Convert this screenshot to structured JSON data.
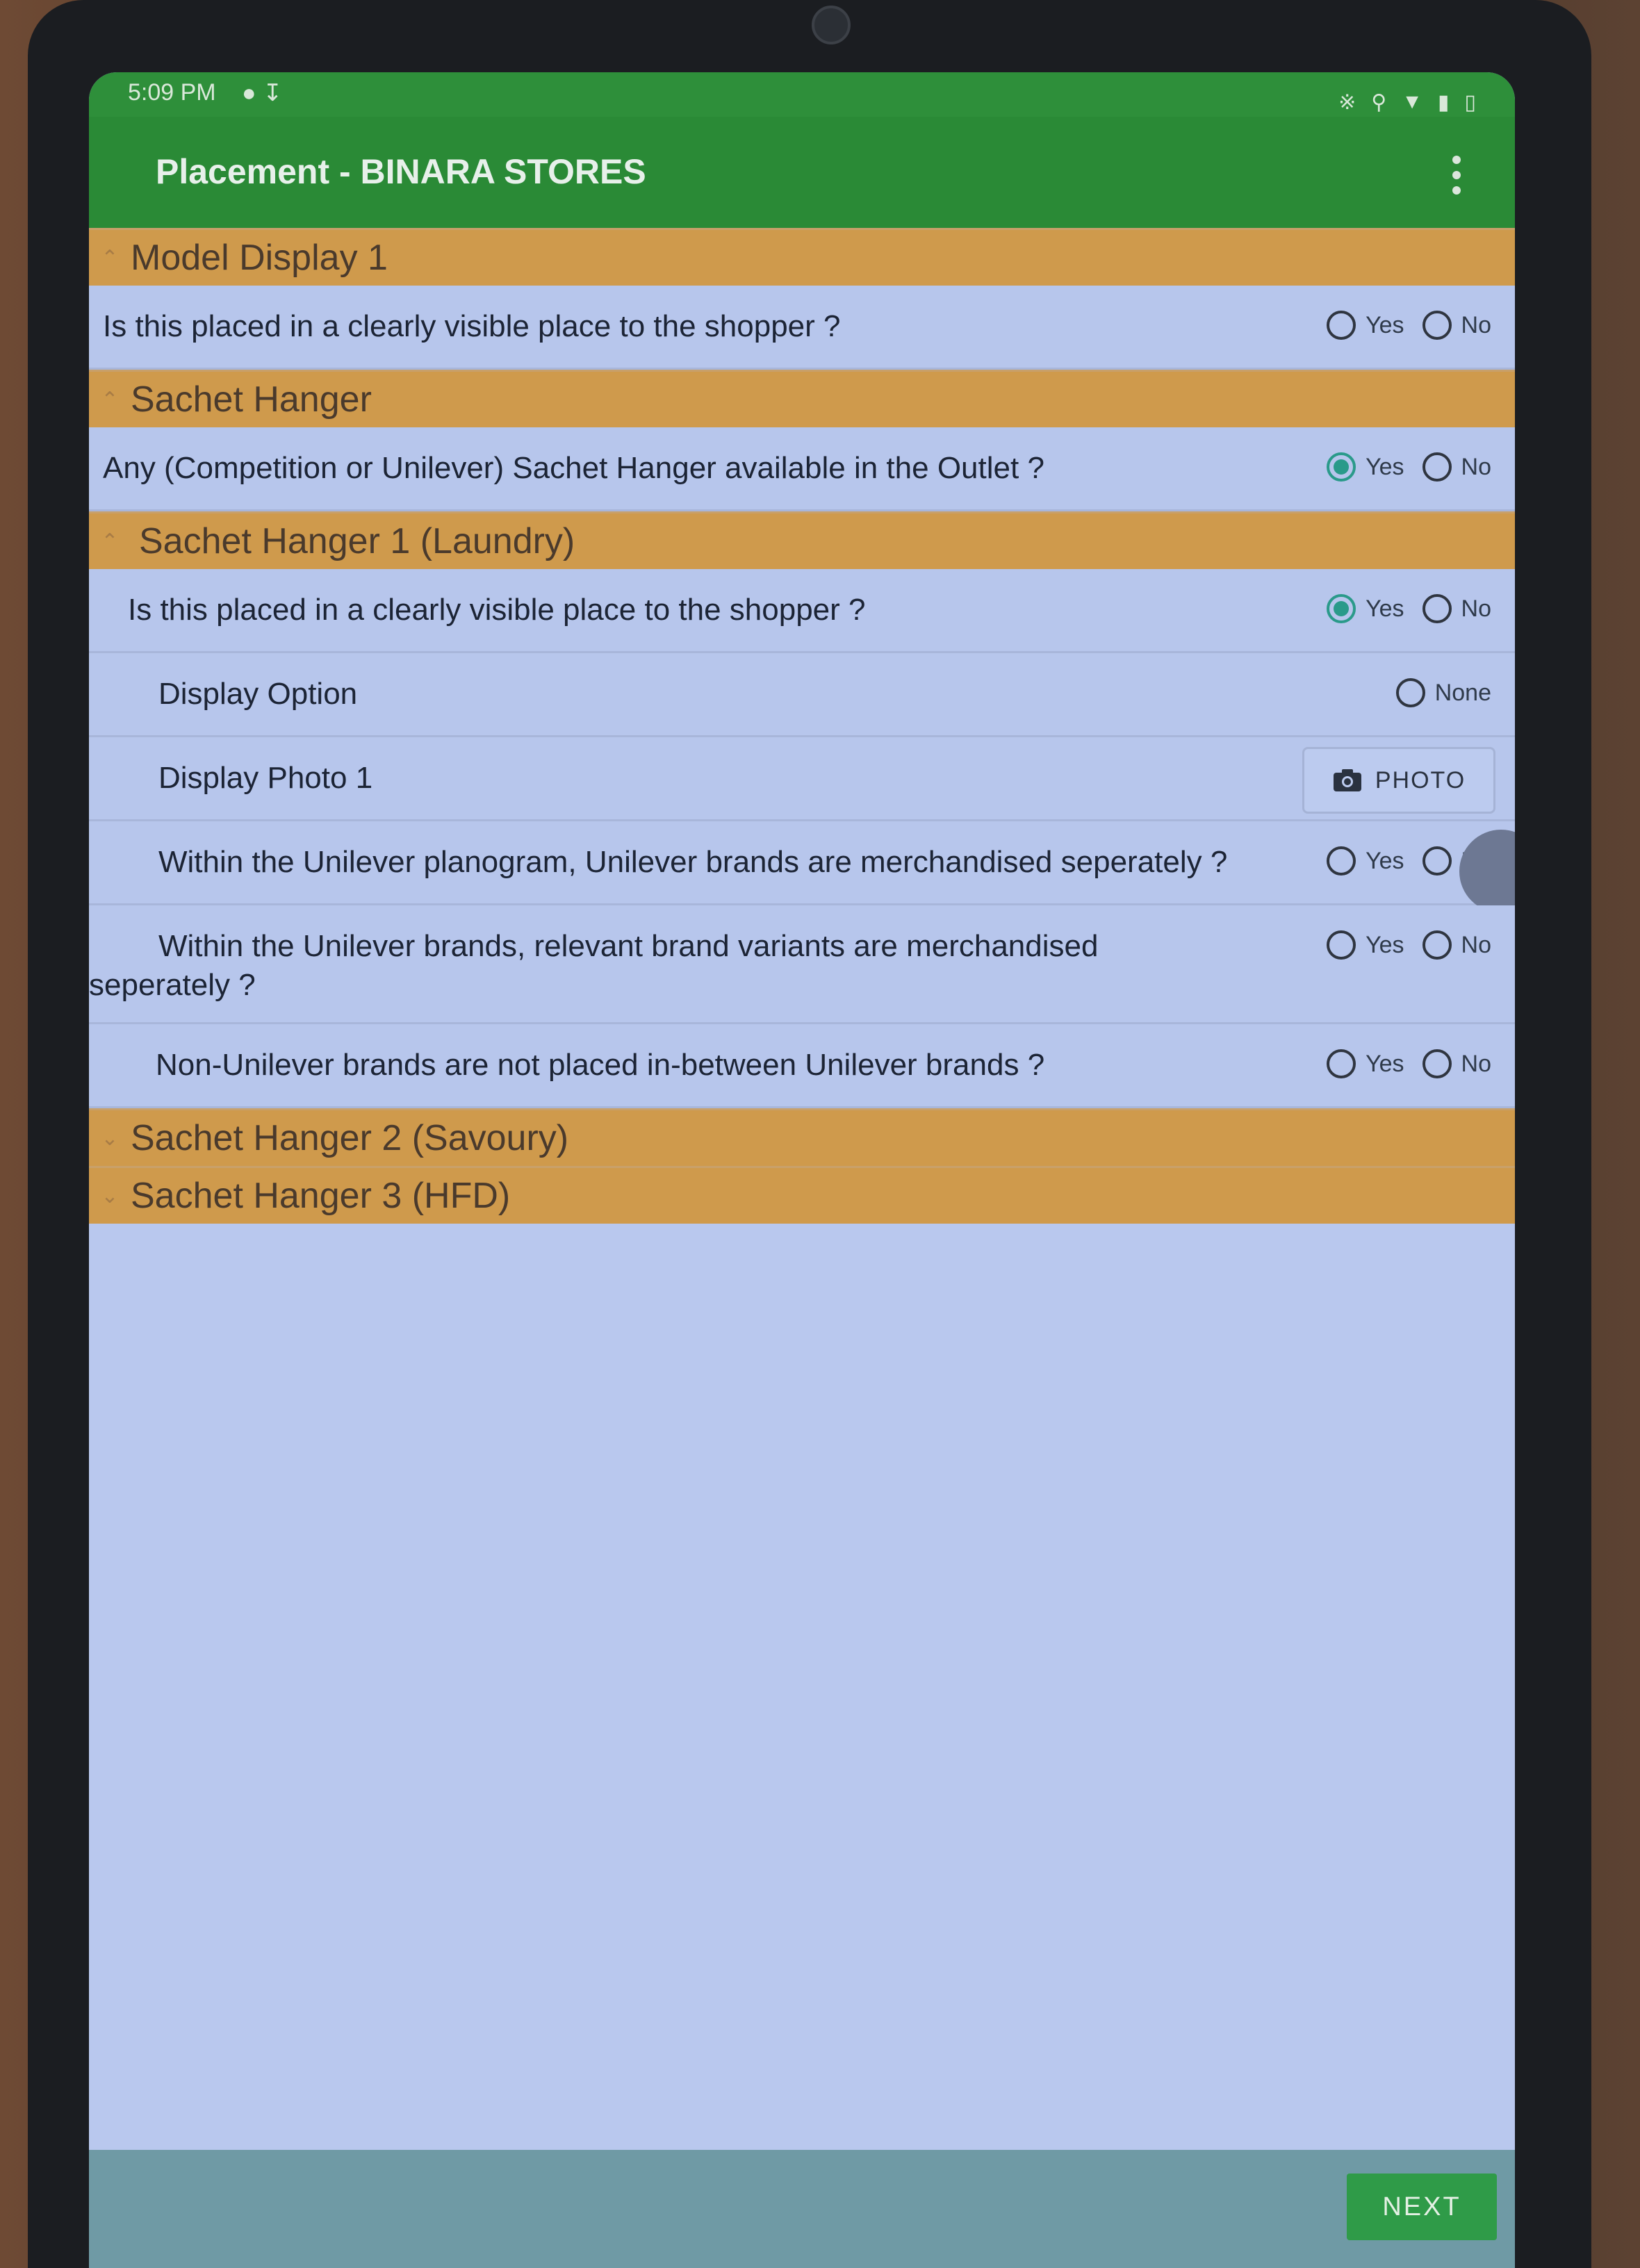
{
  "status": {
    "time": "5:09 PM"
  },
  "app": {
    "title": "Placement - BINARA STORES"
  },
  "sections": {
    "model_display_1": "Model Display 1",
    "sachet_hanger": "Sachet Hanger",
    "sachet_hanger_1": "Sachet Hanger 1 (Laundry)",
    "sachet_hanger_2": "Sachet Hanger 2 (Savoury)",
    "sachet_hanger_3": "Sachet Hanger 3 (HFD)"
  },
  "questions": {
    "q1": "Is this placed in a clearly visible place to the shopper ?",
    "q2": "Any (Competition or Unilever) Sachet Hanger available in the Outlet ?",
    "q3": "Is this placed in a clearly visible place to the shopper ?",
    "q4": "Display Option",
    "q5": "Display Photo 1",
    "q6": "Within the Unilever planogram, Unilever brands are merchandised seperately ?",
    "q7_line1": "Within the Unilever brands, relevant brand variants are merchandised",
    "q7_line2": "seperately ?",
    "q8": "Non-Unilever brands are not placed in-between Unilever brands ?"
  },
  "options": {
    "yes": "Yes",
    "no": "No",
    "none": "None"
  },
  "selected": {
    "q1": "",
    "q2": "Yes",
    "q3": "Yes",
    "q4": "",
    "q6": "",
    "q7": "",
    "q8": ""
  },
  "buttons": {
    "photo": "PHOTO",
    "next": "NEXT"
  },
  "icons": {
    "overflow": "more-vert-icon",
    "camera": "camera-icon",
    "chevron_up": "chevron-up-icon",
    "chevron_down": "chevron-down-icon"
  },
  "colors": {
    "appbar": "#2a8a36",
    "section": "#cf9a4c",
    "row": "#b7c6ec",
    "next": "#2f9b48"
  }
}
